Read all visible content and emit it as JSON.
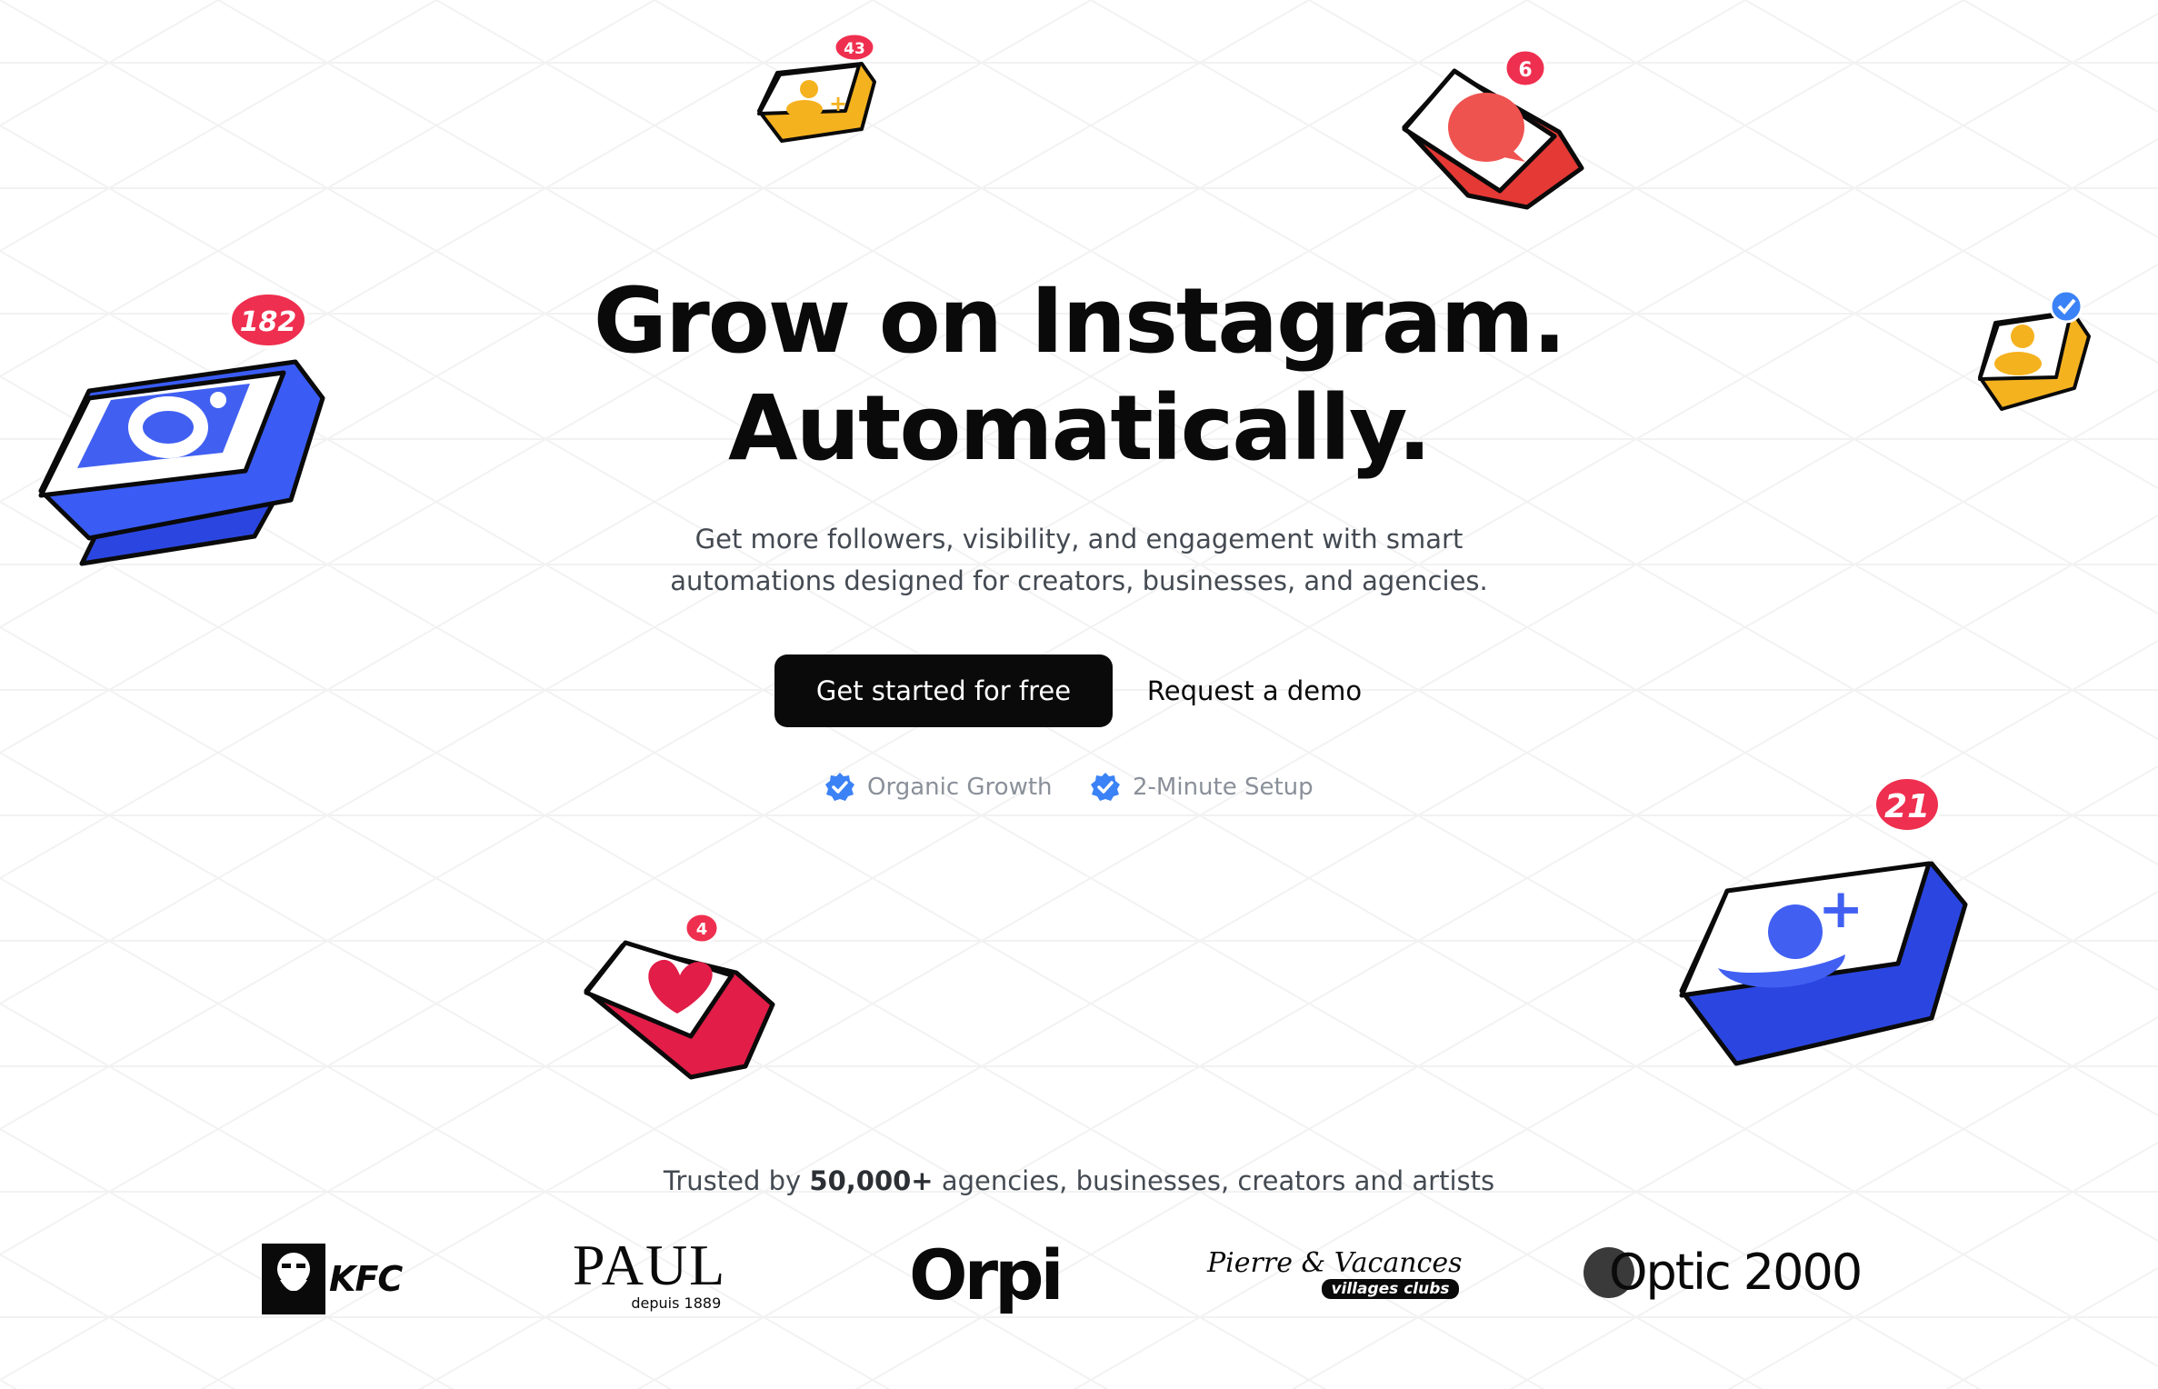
{
  "hero": {
    "headline_line1": "Grow on Instagram.",
    "headline_line2": "Automatically.",
    "subtitle_line1": "Get more followers, visibility, and engagement with smart",
    "subtitle_line2": "automations designed for creators, businesses, and agencies."
  },
  "cta": {
    "primary_label": "Get started for free",
    "secondary_label": "Request a demo"
  },
  "features": [
    {
      "label": "Organic Growth",
      "icon": "verified-badge-icon"
    },
    {
      "label": "2-Minute Setup",
      "icon": "verified-badge-icon"
    }
  ],
  "trusted": {
    "prefix": "Trusted by ",
    "count": "50,000+",
    "suffix": " agencies, businesses, creators and artists"
  },
  "logos": {
    "kfc": "KFC",
    "paul": "PAUL",
    "paul_sub": "depuis 1889",
    "orpi": "Orpi",
    "pv_top": "Pierre & Vacances",
    "pv_sub": "villages clubs",
    "optic": "Optic 2000"
  },
  "badges": {
    "instagram": "182",
    "add_user_small": "43",
    "comment": "6",
    "heart": "4",
    "add_user_large": "21"
  },
  "colors": {
    "primary_button": "#0a0a0a",
    "blue": "#4a6cf7",
    "red": "#ef4444",
    "yellow": "#fbbf24",
    "badge": "#ef2f4f",
    "check": "#3b82f6"
  }
}
